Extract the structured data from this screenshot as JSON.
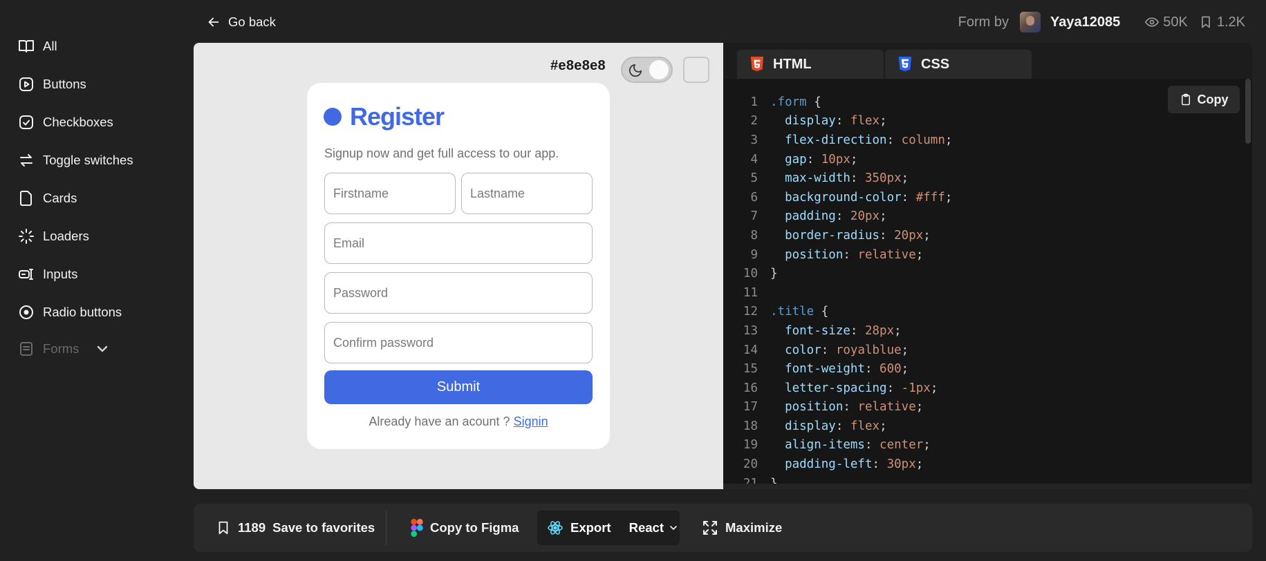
{
  "sidebar": {
    "items": [
      {
        "label": "All",
        "icon": "book-icon"
      },
      {
        "label": "Buttons",
        "icon": "play-circle-icon"
      },
      {
        "label": "Checkboxes",
        "icon": "check-circle-icon"
      },
      {
        "label": "Toggle switches",
        "icon": "arrows-swap-icon"
      },
      {
        "label": "Cards",
        "icon": "card-icon"
      },
      {
        "label": "Loaders",
        "icon": "loader-icon"
      },
      {
        "label": "Inputs",
        "icon": "input-icon"
      },
      {
        "label": "Radio buttons",
        "icon": "radio-icon"
      },
      {
        "label": "Forms",
        "icon": "form-icon"
      }
    ]
  },
  "header": {
    "back_label": "Go back",
    "form_by": "Form by",
    "username": "Yaya12085",
    "views": "50K",
    "saves": "1.2K"
  },
  "preview": {
    "bg_hex": "#e8e8e8",
    "form": {
      "title": "Register",
      "subtitle": "Signup now and get full access to our app.",
      "firstname_placeholder": "Firstname",
      "lastname_placeholder": "Lastname",
      "email_placeholder": "Email",
      "password_placeholder": "Password",
      "confirm_placeholder": "Confirm password",
      "submit_label": "Submit",
      "signin_text": "Already have an acount ?",
      "signin_link": "Signin"
    }
  },
  "code": {
    "tabs": [
      {
        "label": "HTML",
        "icon": "html5-icon"
      },
      {
        "label": "CSS",
        "icon": "css3-icon"
      }
    ],
    "active_tab": "CSS",
    "copy_label": "Copy",
    "lines": [
      [
        [
          "sel",
          ".form"
        ],
        [
          "pun",
          " {"
        ]
      ],
      [
        [
          "prop",
          "  display"
        ],
        [
          "pun",
          ": "
        ],
        [
          "val",
          "flex"
        ],
        [
          "pun",
          ";"
        ]
      ],
      [
        [
          "prop",
          "  flex-direction"
        ],
        [
          "pun",
          ": "
        ],
        [
          "val",
          "column"
        ],
        [
          "pun",
          ";"
        ]
      ],
      [
        [
          "prop",
          "  gap"
        ],
        [
          "pun",
          ": "
        ],
        [
          "val",
          "10px"
        ],
        [
          "pun",
          ";"
        ]
      ],
      [
        [
          "prop",
          "  max-width"
        ],
        [
          "pun",
          ": "
        ],
        [
          "val",
          "350px"
        ],
        [
          "pun",
          ";"
        ]
      ],
      [
        [
          "prop",
          "  background-color"
        ],
        [
          "pun",
          ": "
        ],
        [
          "val",
          "#fff"
        ],
        [
          "pun",
          ";"
        ]
      ],
      [
        [
          "prop",
          "  padding"
        ],
        [
          "pun",
          ": "
        ],
        [
          "val",
          "20px"
        ],
        [
          "pun",
          ";"
        ]
      ],
      [
        [
          "prop",
          "  border-radius"
        ],
        [
          "pun",
          ": "
        ],
        [
          "val",
          "20px"
        ],
        [
          "pun",
          ";"
        ]
      ],
      [
        [
          "prop",
          "  position"
        ],
        [
          "pun",
          ": "
        ],
        [
          "val",
          "relative"
        ],
        [
          "pun",
          ";"
        ]
      ],
      [
        [
          "pun",
          "}"
        ]
      ],
      [],
      [
        [
          "sel",
          ".title"
        ],
        [
          "pun",
          " {"
        ]
      ],
      [
        [
          "prop",
          "  font-size"
        ],
        [
          "pun",
          ": "
        ],
        [
          "val",
          "28px"
        ],
        [
          "pun",
          ";"
        ]
      ],
      [
        [
          "prop",
          "  color"
        ],
        [
          "pun",
          ": "
        ],
        [
          "val",
          "royalblue"
        ],
        [
          "pun",
          ";"
        ]
      ],
      [
        [
          "prop",
          "  font-weight"
        ],
        [
          "pun",
          ": "
        ],
        [
          "val",
          "600"
        ],
        [
          "pun",
          ";"
        ]
      ],
      [
        [
          "prop",
          "  letter-spacing"
        ],
        [
          "pun",
          ": "
        ],
        [
          "val",
          "-1px"
        ],
        [
          "pun",
          ";"
        ]
      ],
      [
        [
          "prop",
          "  position"
        ],
        [
          "pun",
          ": "
        ],
        [
          "val",
          "relative"
        ],
        [
          "pun",
          ";"
        ]
      ],
      [
        [
          "prop",
          "  display"
        ],
        [
          "pun",
          ": "
        ],
        [
          "val",
          "flex"
        ],
        [
          "pun",
          ";"
        ]
      ],
      [
        [
          "prop",
          "  align-items"
        ],
        [
          "pun",
          ": "
        ],
        [
          "val",
          "center"
        ],
        [
          "pun",
          ";"
        ]
      ],
      [
        [
          "prop",
          "  padding-left"
        ],
        [
          "pun",
          ": "
        ],
        [
          "val",
          "30px"
        ],
        [
          "pun",
          ";"
        ]
      ],
      [
        [
          "pun",
          "}"
        ]
      ]
    ]
  },
  "bottom_bar": {
    "favorites_count": "1189",
    "favorites_label": "Save to favorites",
    "figma_label": "Copy to Figma",
    "export_label": "Export",
    "framework_label": "React",
    "maximize_label": "Maximize"
  }
}
